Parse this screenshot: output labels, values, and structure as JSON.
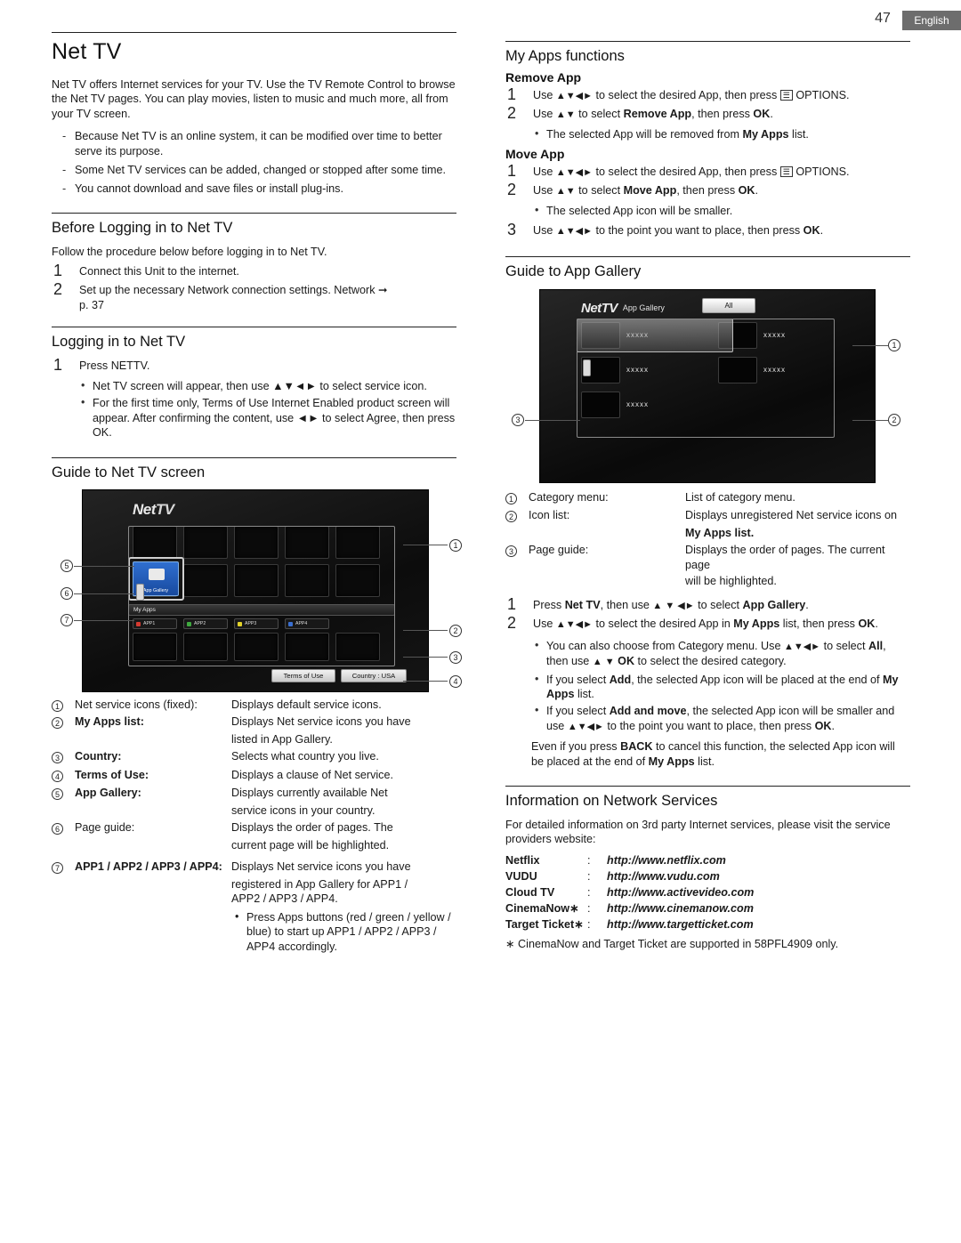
{
  "header": {
    "page_number": "47",
    "language": "English"
  },
  "left": {
    "title": "Net TV",
    "intro": "Net TV offers Internet services for your TV. Use the TV Remote Control to browse the Net TV pages. You can play movies, listen to music and much more, all from your TV screen.",
    "intro_bullets": [
      "Because Net TV is an online system, it can be modified over time to better serve its purpose.",
      "Some Net TV services can be added, changed or stopped after some time.",
      "You cannot download and save files or install plug-ins."
    ],
    "before_login": {
      "heading": "Before Logging in to Net TV",
      "lead": "Follow the procedure below before logging in to Net TV.",
      "steps": [
        "Connect this Unit to the internet.",
        "Set up the necessary Network connection settings. Network"
      ],
      "step2_ref": "p. 37"
    },
    "logging_in": {
      "heading": "Logging in to Net TV",
      "step1": "Press NETTV.",
      "bullets": [
        "Net TV screen will appear, then use ▲▼◄► to select service icon.",
        "For the first time only, Terms of Use Internet Enabled product screen will appear. After confirming the content, use ◄► to select Agree, then press OK."
      ]
    },
    "guide_screen": {
      "heading": "Guide to Net TV screen",
      "tv": {
        "logo_net": "Net",
        "logo_tv": "TV",
        "app_gallery_label": "App Gallery",
        "my_apps_label": "My Apps",
        "app_buttons": [
          {
            "label": "APP1",
            "color": "#d43a30"
          },
          {
            "label": "APP2",
            "color": "#3fa93f"
          },
          {
            "label": "APP3",
            "color": "#e3d32a"
          },
          {
            "label": "APP4",
            "color": "#3a6fd0"
          }
        ],
        "terms_pill": "Terms of Use",
        "country_pill": "Country : USA",
        "callouts": [
          "1",
          "2",
          "3",
          "4",
          "5",
          "6",
          "7"
        ]
      },
      "refs": [
        {
          "n": "1",
          "k": "Net service icons (fixed):",
          "v": "Displays default service icons."
        },
        {
          "n": "2",
          "k": "My Apps list:",
          "v": "Displays Net service icons you have",
          "sub": "listed in App Gallery."
        },
        {
          "n": "3",
          "k": "Country:",
          "v": "Selects what country you live."
        },
        {
          "n": "4",
          "k": "Terms of Use:",
          "v": "Displays a clause of Net service."
        },
        {
          "n": "5",
          "k": "App Gallery:",
          "v": "Displays currently available Net",
          "sub": "service icons in your country."
        },
        {
          "n": "6",
          "k": "Page guide:",
          "v": "Displays the order of pages. The",
          "sub": "current page will be highlighted."
        },
        {
          "n": "7",
          "k": "APP1 / APP2 / APP3 / APP4:",
          "v": "Displays Net service icons you have",
          "sub": "registered in App Gallery for APP1 /",
          "sub2": "APP2 / APP3 / APP4."
        }
      ],
      "final_bullet": "Press Apps buttons (red / green / yellow / blue) to start up APP1 / APP2 / APP3 / APP4 accordingly."
    }
  },
  "right": {
    "my_apps_functions": {
      "heading": "My Apps functions",
      "remove_app": {
        "sub": "Remove App",
        "steps": [
          "Use ▲▼◄► to select the desired App, then press  OPTIONS.",
          "Use ▲▼ to select Remove App, then press OK."
        ],
        "bullet": "The selected App will be removed from My Apps list."
      },
      "move_app": {
        "sub": "Move App",
        "steps": [
          "Use ▲▼◄► to select the desired App, then press  OPTIONS.",
          "Use ▲▼ to select Move App, then press OK.",
          "Use ▲▼◄► to the point you want to place, then press OK."
        ],
        "bullet": "The selected App icon will be smaller."
      }
    },
    "app_gallery": {
      "heading": "Guide to App Gallery",
      "tv": {
        "logo_net": "Net",
        "logo_tv": "TV",
        "title": "App Gallery",
        "all_button": "All",
        "items": [
          "xxxxx",
          "xxxxx",
          "xxxxx",
          "xxxxx",
          "xxxxx"
        ],
        "callouts": [
          "1",
          "2",
          "3"
        ]
      },
      "refs": [
        {
          "n": "1",
          "k": "Category menu:",
          "v": "List of category menu."
        },
        {
          "n": "2",
          "k": "Icon list:",
          "v": "Displays unregistered Net service icons on",
          "sub": "My Apps list."
        },
        {
          "n": "3",
          "k": "Page guide:",
          "v": "Displays the order of pages. The current page",
          "sub": "will be highlighted."
        }
      ],
      "steps": [
        "Press Net TV, then use ▲▼◄► to select App Gallery.",
        "Use ▲▼◄► to select the desired App in My Apps list, then press OK."
      ],
      "bullets": [
        "You can also choose from Category menu. Use ▲▼◄► to select All, then use ▲▼ OK to select the desired category.",
        "If you select Add, the selected App icon will be placed at the end of My Apps list.",
        "If you select Add and move, the selected App icon will be smaller and use ▲▼◄► to the point you want to place, then press OK."
      ],
      "note": "Even if you press BACK to cancel this function, the selected App icon will be placed at the end of My Apps list."
    },
    "network_services": {
      "heading": "Information on Network Services",
      "lead": "For detailed information on 3rd party Internet services, please visit the service providers website:",
      "rows": [
        {
          "name": "Netflix",
          "sep": ":",
          "url": "http://www.netflix.com"
        },
        {
          "name": "VUDU",
          "sep": ":",
          "url": "http://www.vudu.com"
        },
        {
          "name": "Cloud TV",
          "sep": ":",
          "url": "http://www.activevideo.com"
        },
        {
          "name": "CinemaNow∗",
          "sep": ":",
          "url": "http://www.cinemanow.com"
        },
        {
          "name": "Target Ticket∗",
          "sep": ":",
          "url": "http://www.targetticket.com"
        }
      ],
      "footnote": "∗ CinemaNow and Target Ticket are supported in 58PFL4909 only."
    }
  }
}
